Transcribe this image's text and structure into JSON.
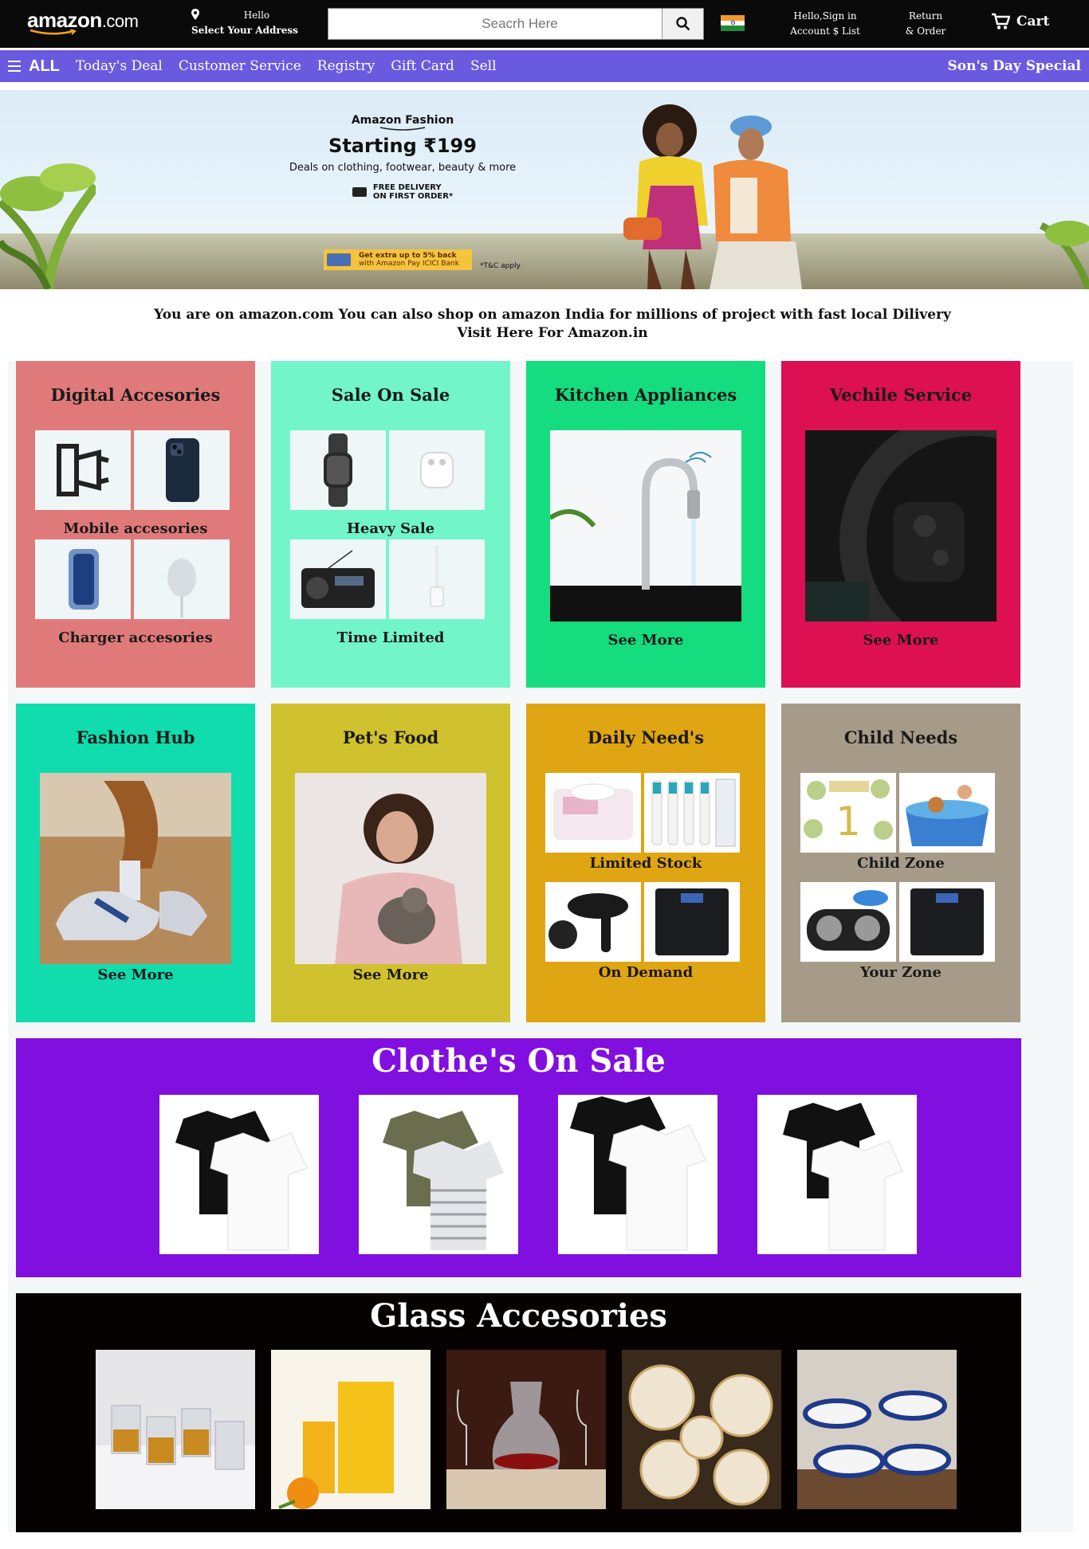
{
  "header": {
    "logo_text": "amazon",
    "logo_suffix": ".com",
    "address_line1": "Hello",
    "address_line2": "Select Your Address",
    "search_placeholder": "Seacrh Here",
    "signin_line1": "Hello,Sign in",
    "signin_line2": "Account $ List",
    "returns_line1": "Return",
    "returns_line2": "& Order",
    "cart_label": "Cart",
    "icons": [
      "location-pin-icon",
      "search-icon",
      "india-flag-icon",
      "cart-icon"
    ]
  },
  "nav": {
    "all_label": "ALL",
    "links": [
      "Today's Deal",
      "Customer Service",
      "Registry",
      "Gift Card",
      "Sell"
    ],
    "special": "Son's Day Special"
  },
  "hero": {
    "brand": "Amazon Fashion",
    "price": "Starting ₹199",
    "deals": "Deals on clothing, footwear, beauty & more",
    "delivery_line1": "FREE DELIVERY",
    "delivery_line2": "ON FIRST ORDER*",
    "cashback_line1": "Get extra up to 5% back",
    "cashback_line2": "with Amazon Pay ICICI Bank",
    "tc": "*T&C apply"
  },
  "notice": {
    "line1": "You are on amazon.com You can also shop on amazon India for millions of project with fast local Dilivery",
    "line2": "Visit Here For Amazon.in"
  },
  "cards": [
    {
      "title": "Digital Accesories",
      "labels": [
        "Mobile accesories",
        "Charger accesories"
      ],
      "color": "#e07a7a"
    },
    {
      "title": "Sale On Sale",
      "labels": [
        "Heavy Sale",
        "Time Limited"
      ],
      "color": "#72f5c8"
    },
    {
      "title": "Kitchen Appliances",
      "labels": [
        "See More"
      ],
      "color": "#15dc7e"
    },
    {
      "title": "Vechile Service",
      "labels": [
        "See More"
      ],
      "color": "#dd1053"
    },
    {
      "title": "Fashion Hub",
      "labels": [
        "See More"
      ],
      "color": "#10dcae"
    },
    {
      "title": "Pet's Food",
      "labels": [
        "See More"
      ],
      "color": "#d0c12e"
    },
    {
      "title": "Daily Need's",
      "labels": [
        "Limited Stock",
        "On Demand"
      ],
      "color": "#dfa512"
    },
    {
      "title": "Child Needs",
      "labels": [
        "Child Zone",
        "Your Zone"
      ],
      "color": "#a69b88"
    }
  ],
  "clothes": {
    "title": "Clothe's On Sale",
    "color": "#810fe0",
    "items": 4
  },
  "glass": {
    "title": "Glass Accesories",
    "color": "#060202",
    "items": 5
  }
}
